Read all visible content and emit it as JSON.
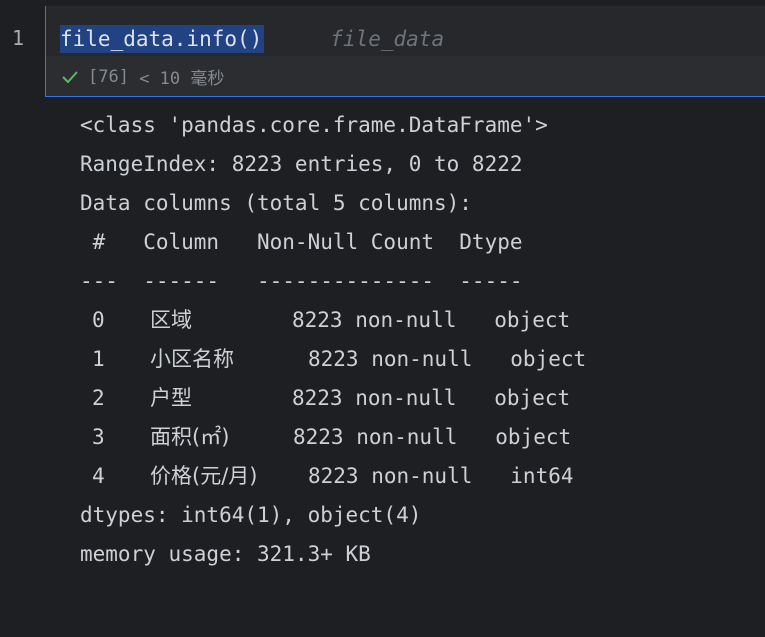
{
  "cell": {
    "line_number": "1",
    "code": "file_data.info()",
    "inline_hint": "file_data",
    "exec_count": "[76]",
    "exec_time": "< 10 毫秒",
    "status_color": "#5fb865",
    "selection_color": "#214283",
    "border_color": "#3574f0"
  },
  "output": {
    "class_line": "<class 'pandas.core.frame.DataFrame'>",
    "range_index_line": "RangeIndex: 8223 entries, 0 to 8222",
    "data_columns_line": "Data columns (total 5 columns):",
    "header_line": " #   Column   Non-Null Count  Dtype ",
    "separator_line": "---  ------   --------------  ----- ",
    "rows": [
      {
        "num": "0",
        "column": "区域",
        "stats": "8223 non-null   object"
      },
      {
        "num": "1",
        "column": "小区名称",
        "stats": "8223 non-null   object"
      },
      {
        "num": "2",
        "column": "户型",
        "stats": "8223 non-null   object"
      },
      {
        "num": "3",
        "column": "面积(㎡)",
        "stats": "8223 non-null   object"
      },
      {
        "num": "4",
        "column": "价格(元/月)",
        "stats": "8223 non-null   int64"
      }
    ],
    "dtypes_line": "dtypes: int64(1), object(4)",
    "memory_line": "memory usage: 321.3+ KB"
  }
}
